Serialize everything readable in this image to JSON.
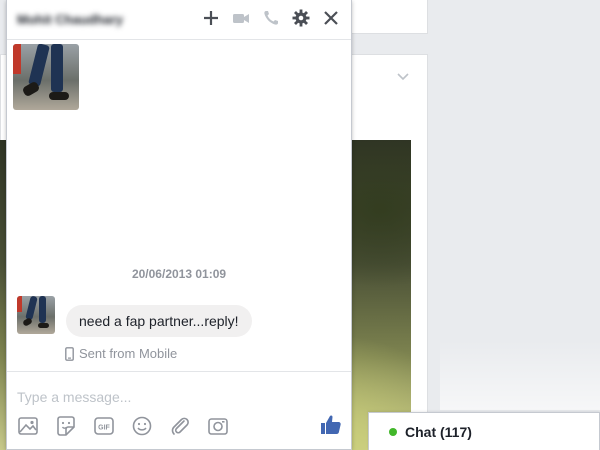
{
  "conversation": {
    "contact_name": "Mohit Chaudhary"
  },
  "header_icons": [
    "plus-icon",
    "video-camera-icon",
    "phone-icon",
    "gear-icon",
    "close-icon"
  ],
  "messages": {
    "timestamp": "20/06/2013 01:09",
    "text": "need a fap partner...reply!",
    "sent_from": "Sent from Mobile"
  },
  "composer": {
    "placeholder": "Type a message...",
    "tools": [
      "photo-icon",
      "sticker-icon",
      "gif-icon",
      "emoji-icon",
      "attachment-icon",
      "camera-icon",
      "thumbs-up-icon"
    ]
  },
  "chat_bar": {
    "label": "Chat (117)",
    "status_color": "#42b72a"
  },
  "colors": {
    "accent": "#4267b2",
    "online": "#42b72a",
    "bubble": "#f1f0f0"
  }
}
